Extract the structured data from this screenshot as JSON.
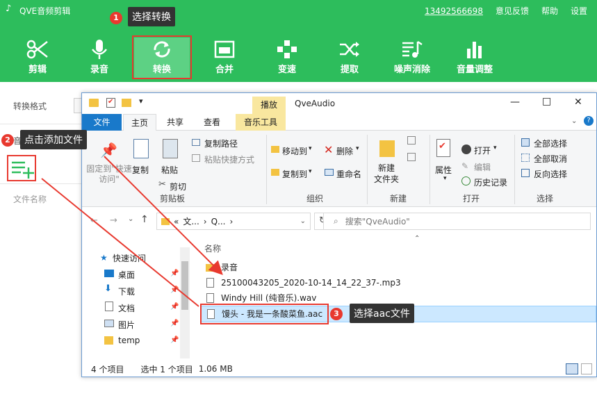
{
  "app": {
    "title": "QVE音频剪辑",
    "phone": "13492566698",
    "menu": [
      "意见反馈",
      "帮助",
      "设置"
    ],
    "window_controls": [
      "—",
      "□",
      "✕"
    ],
    "toolbar": [
      {
        "label": "剪辑",
        "icon": "scissors-icon"
      },
      {
        "label": "录音",
        "icon": "microphone-icon"
      },
      {
        "label": "转换",
        "icon": "convert-icon"
      },
      {
        "label": "合并",
        "icon": "merge-icon"
      },
      {
        "label": "变速",
        "icon": "speed-icon"
      },
      {
        "label": "提取",
        "icon": "extract-icon"
      },
      {
        "label": "噪声消除",
        "icon": "noise-reduction-icon"
      },
      {
        "label": "音量调整",
        "icon": "volume-adjust-icon"
      }
    ],
    "left": {
      "format_label": "转换格式",
      "sound_label": "音",
      "filename_label": "文件名称"
    }
  },
  "callouts": {
    "step1": {
      "num": "1",
      "text": "选择转换"
    },
    "step2": {
      "num": "2",
      "text": "点击添加文件"
    },
    "step3": {
      "num": "3",
      "text": "选择aac文件"
    }
  },
  "explorer": {
    "title": "QveAudio",
    "window_controls": [
      "—",
      "□",
      "✕"
    ],
    "context_tab": "播放",
    "tabs": [
      "文件",
      "主页",
      "共享",
      "查看",
      "音乐工具"
    ],
    "ribbon": {
      "clipboard": {
        "pin": "固定到\"快速访问\"",
        "copy": "复制",
        "paste": "粘贴",
        "copy_path": "复制路径",
        "paste_shortcut": "粘贴快捷方式",
        "cut": "剪切",
        "label": "剪贴板"
      },
      "organize": {
        "move_to": "移动到",
        "copy_to": "复制到",
        "delete": "删除",
        "rename": "重命名",
        "label": "组织"
      },
      "new": {
        "new_folder": "新建\n文件夹",
        "label": "新建"
      },
      "open": {
        "properties": "属性",
        "open": "打开",
        "edit": "编辑",
        "history": "历史记录",
        "label": "打开"
      },
      "select": {
        "select_all": "全部选择",
        "select_none": "全部取消",
        "invert": "反向选择",
        "label": "选择"
      }
    },
    "address": {
      "crumbs": [
        "«",
        "文...",
        "›",
        "Q...",
        "›"
      ],
      "search_placeholder": "搜索\"QveAudio\""
    },
    "nav": [
      "快速访问",
      "桌面",
      "下载",
      "文档",
      "图片",
      "temp"
    ],
    "column_name": "名称",
    "files": [
      {
        "name": "录音",
        "type": "folder"
      },
      {
        "name": "25100043205_2020-10-14_14_22_37-.mp3",
        "type": "audio"
      },
      {
        "name": "Windy Hill (纯音乐).wav",
        "type": "audio"
      },
      {
        "name": "馒头 - 我是一条酸菜鱼.aac",
        "type": "audio",
        "selected": true
      }
    ],
    "status": {
      "count": "4 个项目",
      "selected": "选中 1 个项目",
      "size": "1.06 MB"
    }
  },
  "colors": {
    "app_green": "#2dbd5c",
    "callout_red": "#e8392f",
    "explorer_blue": "#1979ca"
  }
}
